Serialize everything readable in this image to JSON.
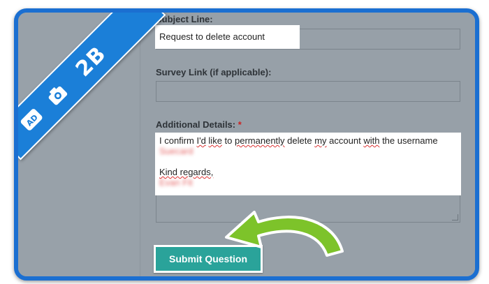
{
  "form": {
    "subject_label": "Subject Line:",
    "subject_value": "Request to delete account",
    "survey_label": "Survey Link (if applicable):",
    "survey_value": "",
    "details_label": "Additional Details:",
    "details_required_mark": "*",
    "details_line1_parts": [
      "I confirm ",
      "I'd",
      " ",
      "like",
      " to ",
      "permanently",
      " delete ",
      "my",
      " account ",
      "with",
      " the username"
    ],
    "details_redacted_username": "Suecard",
    "details_closing": "Kind regards,",
    "details_redacted_name": "Evan Fit",
    "submit_label": "Submit Question"
  },
  "watermark": {
    "brand": "2B",
    "badge": "AD"
  },
  "colors": {
    "frame": "#1b6fd1",
    "button": "#2aa39a",
    "arrow": "#7dc32a",
    "background": "#9aa3ac"
  }
}
